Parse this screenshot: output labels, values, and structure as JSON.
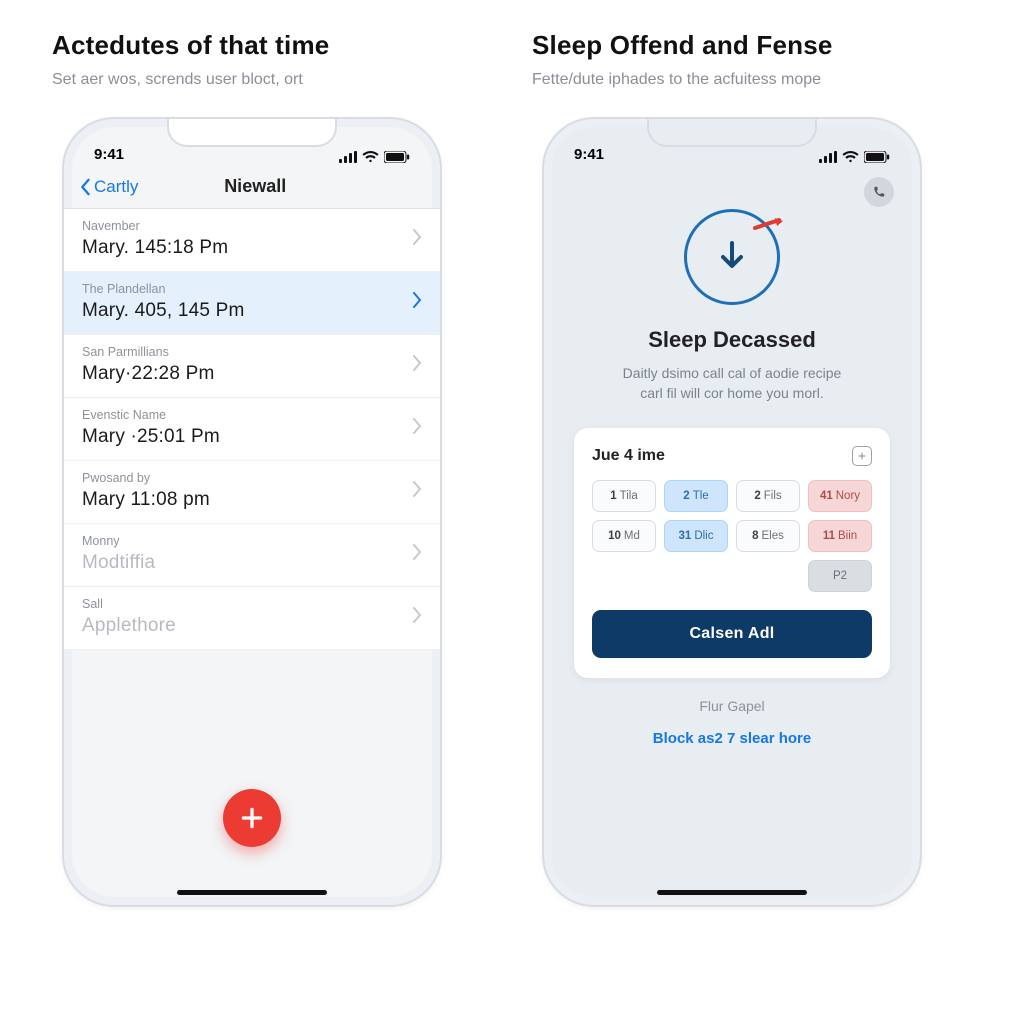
{
  "left": {
    "section_title": "Actedutes of that time",
    "section_sub": "Set aer wos, scrends user bloct, ort",
    "status_time": "9:41",
    "back_label": "Cartly",
    "nav_title": "Niewall",
    "rows": [
      {
        "caption": "Navember",
        "title": "Mary. 145:18 Pm"
      },
      {
        "caption": "The Plandellan",
        "title": "Mary. 405, 145 Pm"
      },
      {
        "caption": "San Parmillians",
        "title": "Mary·22:28 Pm"
      },
      {
        "caption": "Evenstic Name",
        "title": "Mary ·25:01 Pm"
      },
      {
        "caption": "Pwosand by",
        "title": "Mary 11:08 pm"
      },
      {
        "caption": "Monny",
        "title": "Modtiffia"
      },
      {
        "caption": "Sall",
        "title": "Applethore"
      }
    ],
    "selected_index": 1
  },
  "right": {
    "section_title": "Sleep Offend and Fense",
    "section_sub": "Fette/dute iphades to the acfuitess mope",
    "status_time": "9:41",
    "hero_title": "Sleep Decassed",
    "hero_desc_l1": "Daitly dsimo call cal of aodie recipe",
    "hero_desc_l2": "carl fil will cor home you morl.",
    "card_title": "Jue 4 ime",
    "chips": [
      {
        "n": "1",
        "t": "Tila",
        "style": ""
      },
      {
        "n": "2",
        "t": "Tle",
        "style": "blue"
      },
      {
        "n": "2",
        "t": "Fils",
        "style": ""
      },
      {
        "n": "41",
        "t": "Nory",
        "style": "pink"
      },
      {
        "n": "10",
        "t": "Md",
        "style": ""
      },
      {
        "n": "31",
        "t": "Dlic",
        "style": "blue"
      },
      {
        "n": "8",
        "t": "Eles",
        "style": ""
      },
      {
        "n": "11",
        "t": "Biin",
        "style": "pink"
      },
      {
        "n": "",
        "t": "",
        "style": "placeholder"
      },
      {
        "n": "",
        "t": "",
        "style": "placeholder"
      },
      {
        "n": "",
        "t": "",
        "style": "placeholder"
      },
      {
        "n": "",
        "t": "P2",
        "style": "grey"
      }
    ],
    "cta_label": "Calsen Adl",
    "footer_text": "Flur Gapel",
    "footer_link": "Block as2 7 slear hore"
  },
  "colors": {
    "accent_blue": "#1677e5",
    "fab_red": "#ec3b33",
    "cta_navy": "#0d3a66"
  }
}
